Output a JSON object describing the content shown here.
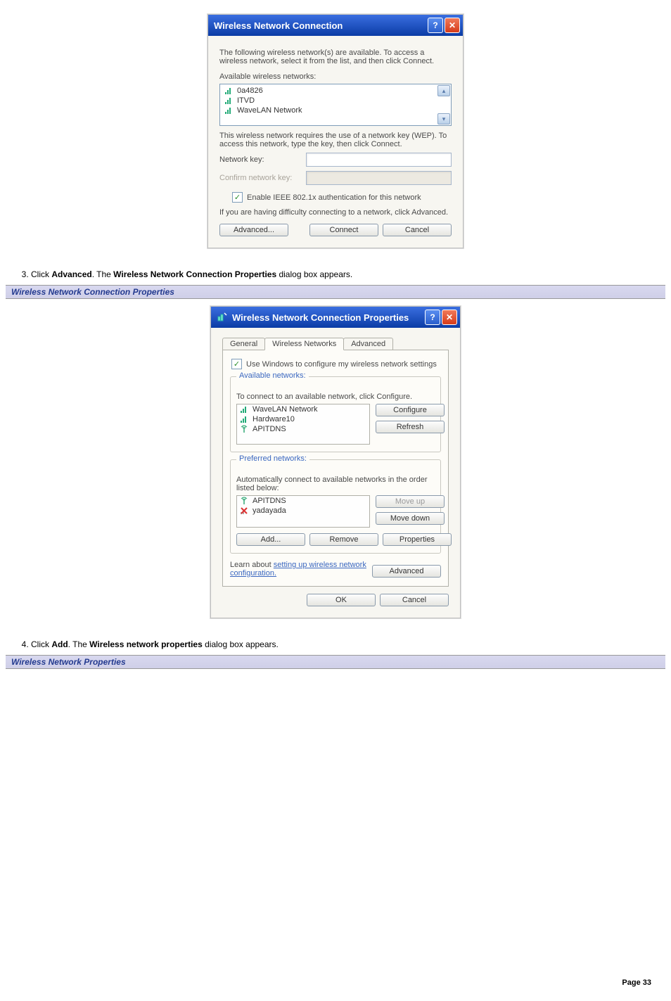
{
  "dlg1": {
    "title": "Wireless Network Connection",
    "intro": "The following wireless network(s) are available. To access a wireless network, select it from the list, and then click Connect.",
    "available_label": "Available wireless networks:",
    "networks": [
      "0a4826",
      "ITVD",
      "WaveLAN Network"
    ],
    "wep_text": "This wireless network requires the use of a network key (WEP). To access this network, type the key, then click Connect.",
    "network_key_label": "Network key:",
    "confirm_key_label": "Confirm network key:",
    "ieee_label": "Enable IEEE 802.1x authentication for this network",
    "difficulty_text": "If you are having difficulty connecting to a network, click Advanced.",
    "advanced_btn": "Advanced...",
    "connect_btn": "Connect",
    "cancel_btn": "Cancel"
  },
  "step3": {
    "num": "3.",
    "pre": "Click ",
    "bold1": "Advanced",
    "mid": ". The ",
    "bold2": "Wireless Network Connection Properties",
    "post": " dialog box appears."
  },
  "section1_title": "Wireless Network Connection Properties",
  "dlg2": {
    "title": "Wireless Network Connection Properties",
    "tabs": [
      "General",
      "Wireless Networks",
      "Advanced"
    ],
    "use_windows_label": "Use Windows to configure my wireless network settings",
    "grp_available": "Available networks:",
    "avail_hint": "To connect to an available network, click Configure.",
    "avail_list": [
      "WaveLAN Network",
      "Hardware10",
      "APITDNS"
    ],
    "configure_btn": "Configure",
    "refresh_btn": "Refresh",
    "grp_preferred": "Preferred networks:",
    "pref_hint": "Automatically connect to available networks in the order listed below:",
    "pref_list": [
      "APITDNS",
      "yadayada"
    ],
    "moveup_btn": "Move up",
    "movedown_btn": "Move down",
    "add_btn": "Add...",
    "remove_btn": "Remove",
    "properties_btn": "Properties",
    "learn_pre": "Learn about ",
    "learn_link": "setting up wireless network configuration.",
    "advanced_btn": "Advanced",
    "ok_btn": "OK",
    "cancel_btn": "Cancel"
  },
  "step4": {
    "num": "4.",
    "pre": "Click ",
    "bold1": "Add",
    "mid": ". The ",
    "bold2": "Wireless network properties",
    "post": " dialog box appears."
  },
  "section2_title": "Wireless Network Properties",
  "page_label": "Page 33"
}
